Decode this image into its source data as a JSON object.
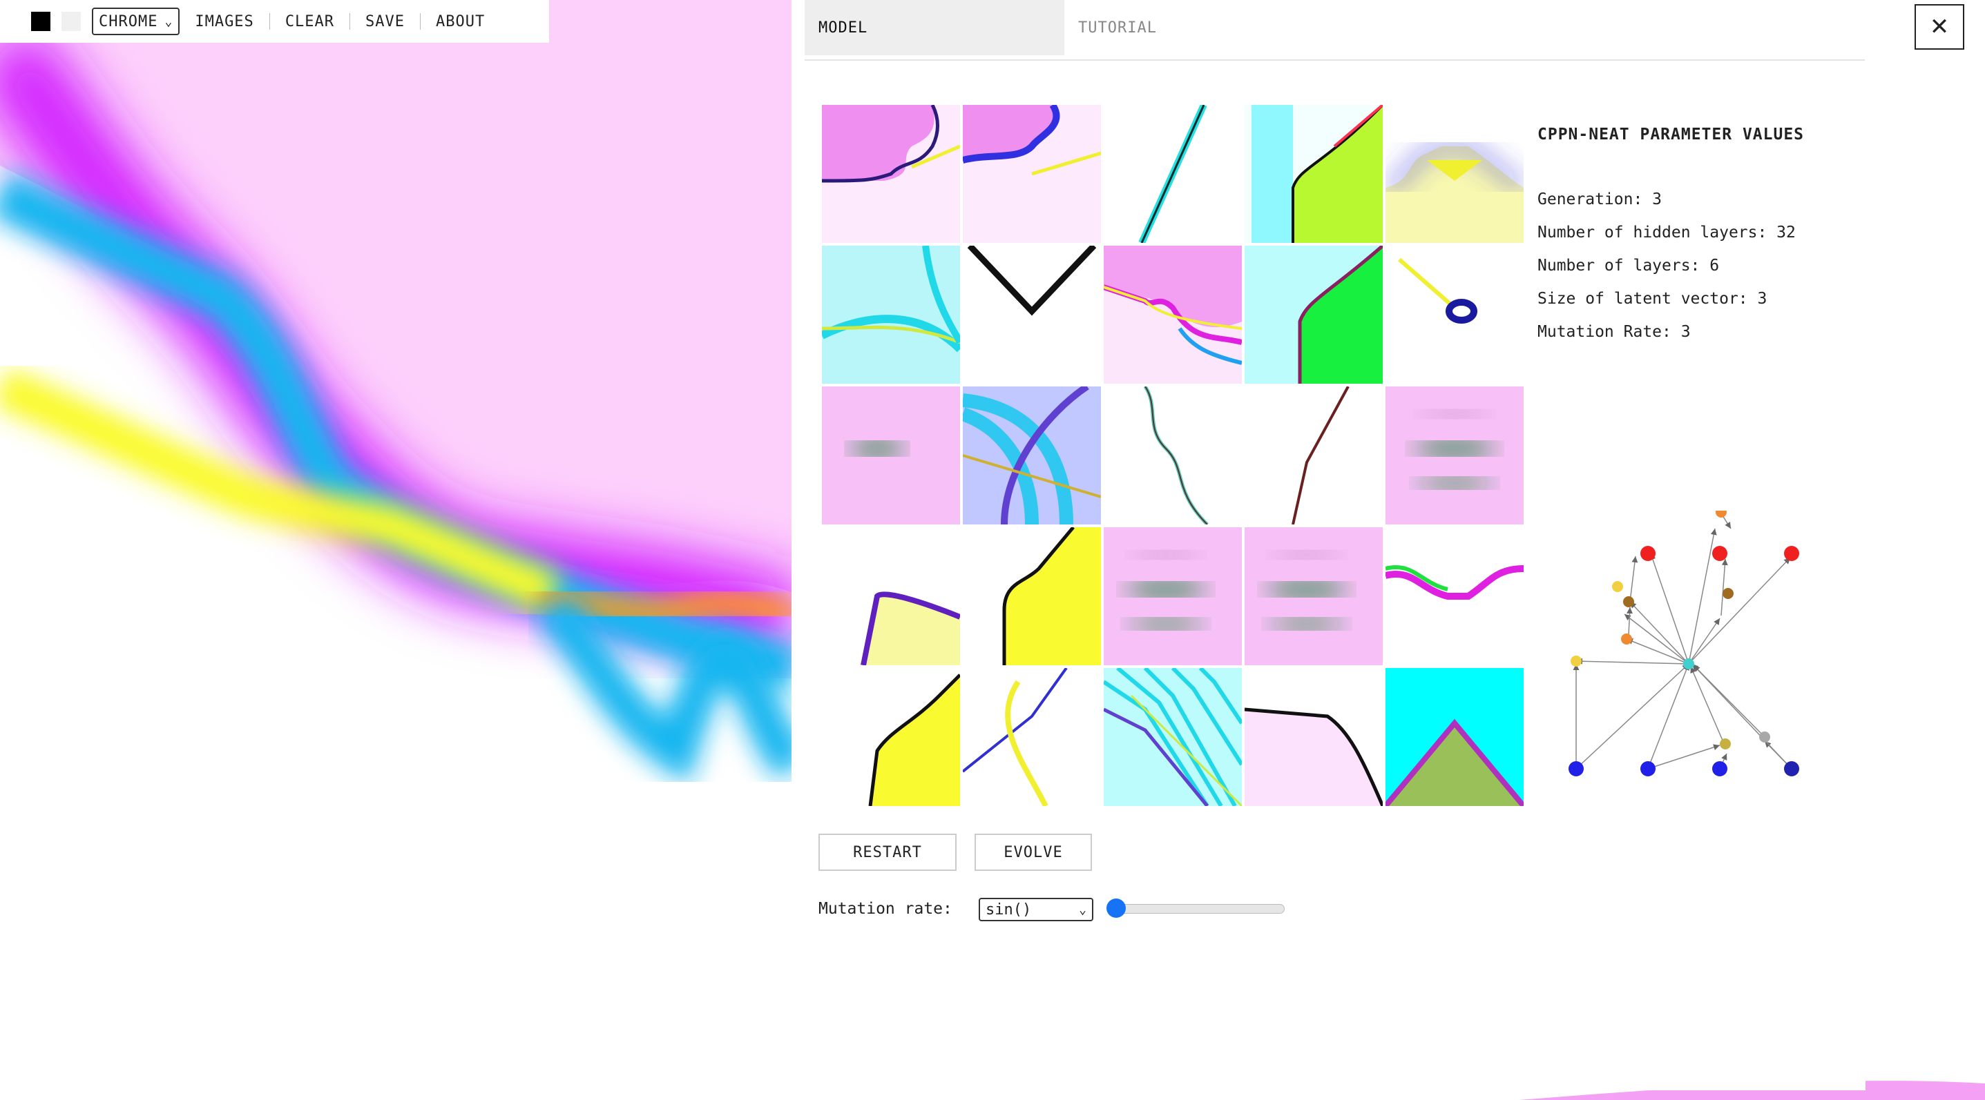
{
  "toolbar": {
    "style_select": "CHROME",
    "links": [
      "IMAGES",
      "CLEAR",
      "SAVE",
      "ABOUT"
    ]
  },
  "tabs": [
    "MODEL",
    "TUTORIAL"
  ],
  "close_label": "✕",
  "params": {
    "title": "CPPN-NEAT PARAMETER VALUES",
    "lines": [
      "Generation: 3",
      "Number of hidden layers: 32",
      "Number of layers: 6",
      "Size of latent vector: 3",
      "Mutation Rate: 3"
    ]
  },
  "buttons": {
    "restart": "RESTART",
    "evolve": "EVOLVE"
  },
  "mutation": {
    "label": "Mutation rate:",
    "function": "sin()",
    "slider_fraction": 0.0
  },
  "colors": {
    "magenta": "#d11aff",
    "pink": "#fdd0fc",
    "cyan": "#15b6f0",
    "yellow": "#fafa2a",
    "green": "#12f03c",
    "aqua": "#00ffff",
    "orange": "#ff9a1a",
    "node_red": "#f02020",
    "node_blue": "#2020e8",
    "node_teal": "#40d0d0",
    "slider_blue": "#1773f5"
  }
}
